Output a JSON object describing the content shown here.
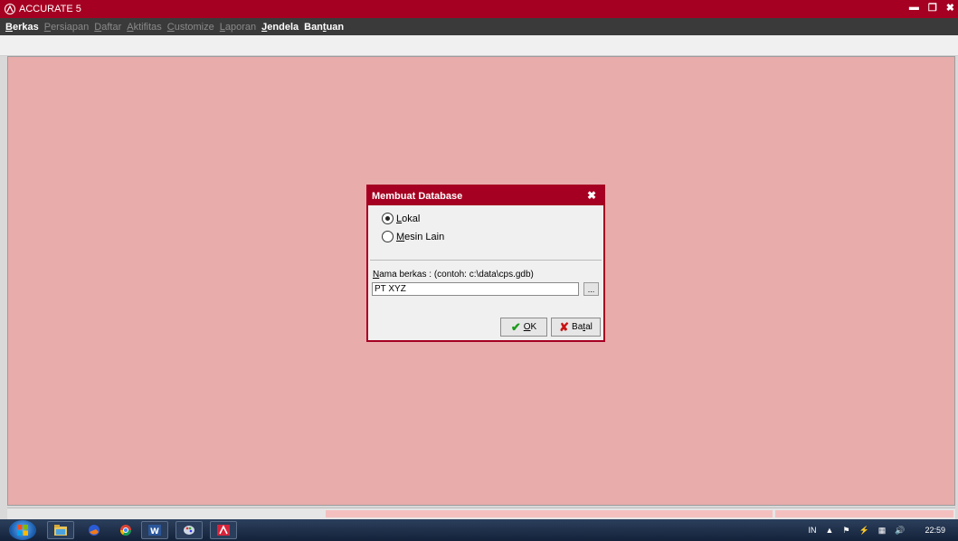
{
  "window": {
    "title": "ACCURATE 5",
    "controls": {
      "minimize": "▬",
      "restore": "❐",
      "close": "✖"
    }
  },
  "menu": {
    "items": [
      {
        "label": "Berkas",
        "accel": "B",
        "rest": "erkas",
        "enabled": true
      },
      {
        "label": "Persiapan",
        "accel": "P",
        "rest": "ersiapan",
        "enabled": false
      },
      {
        "label": "Daftar",
        "accel": "D",
        "rest": "aftar",
        "enabled": false
      },
      {
        "label": "Aktifitas",
        "accel": "A",
        "rest": "ktifitas",
        "enabled": false
      },
      {
        "label": "Customize",
        "accel": "C",
        "rest": "ustomize",
        "enabled": false
      },
      {
        "label": "Laporan",
        "accel": "L",
        "rest": "aporan",
        "enabled": false
      },
      {
        "label": "Jendela",
        "accel": "J",
        "rest": "endela",
        "enabled": true
      },
      {
        "label": "Bantuan",
        "pre": "Ban",
        "accel": "t",
        "rest": "uan",
        "enabled": true
      }
    ]
  },
  "dialog": {
    "title": "Membuat Database",
    "close": "✖",
    "radio_lokal": {
      "accel": "L",
      "rest": "okal",
      "selected": true
    },
    "radio_mesin": {
      "accel": "M",
      "rest": "esin Lain",
      "selected": false
    },
    "nama_label_accel": "N",
    "nama_label_rest": "ama berkas :  (contoh: c:\\data\\cps.gdb)",
    "file_value": "PT XYZ",
    "browse_label": "...",
    "ok": {
      "accel": "O",
      "rest": "K",
      "icon": "✔"
    },
    "batal": {
      "pre": "Ba",
      "accel": "t",
      "rest": "al",
      "icon": "✘"
    }
  },
  "taskbar": {
    "language": "IN",
    "clock": "22:59",
    "tray_icons": {
      "arrow": "▲",
      "flag": "⚑",
      "power": "⚡",
      "network": "▦",
      "volume": "🔊"
    }
  },
  "colors": {
    "brand": "#a50021",
    "desktop": "#e8acab",
    "ok_check": "#1b9a1b",
    "cancel_x": "#c81414"
  }
}
